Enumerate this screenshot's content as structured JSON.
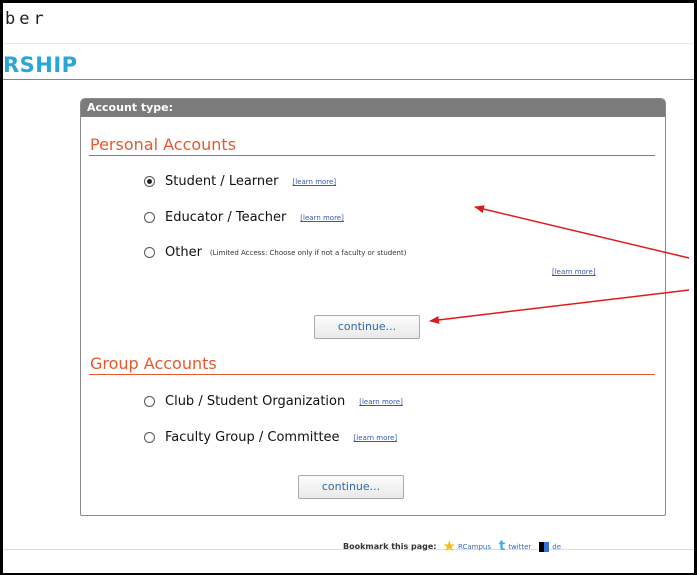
{
  "header": {
    "partial_word": "ber",
    "section_title": "RSHIP"
  },
  "panel": {
    "header_label": "Account type:",
    "personal": {
      "title": "Personal Accounts",
      "options": [
        {
          "label": "Student / Learner",
          "checked": true,
          "learn_more": "[learn more]"
        },
        {
          "label": "Educator / Teacher",
          "checked": false,
          "learn_more": "[learn more]"
        },
        {
          "label": "Other",
          "checked": false,
          "note": "(Limited Access: Choose only if not a faculty or student)",
          "learn_more": "[learn more]"
        }
      ],
      "continue_label": "continue..."
    },
    "group": {
      "title": "Group Accounts",
      "options": [
        {
          "label": "Club / Student Organization",
          "checked": false,
          "learn_more": "[learn more]"
        },
        {
          "label": "Faculty Group / Committee",
          "checked": false,
          "learn_more": "[learn more]"
        }
      ],
      "continue_label": "continue..."
    }
  },
  "footer": {
    "bookmark_label": "Bookmark this page:",
    "links": [
      {
        "label": "RCampus",
        "icon": "star-icon"
      },
      {
        "label": "twitter",
        "icon": "twitter-icon"
      },
      {
        "label": "de",
        "icon": "delicious-icon"
      }
    ]
  },
  "colors": {
    "title_blue": "#2aa6d6",
    "group_orange": "#e8582e",
    "panel_header_gray": "#7b7b7b",
    "arrow_red": "#e01a1a",
    "link_blue": "#3555b8"
  }
}
